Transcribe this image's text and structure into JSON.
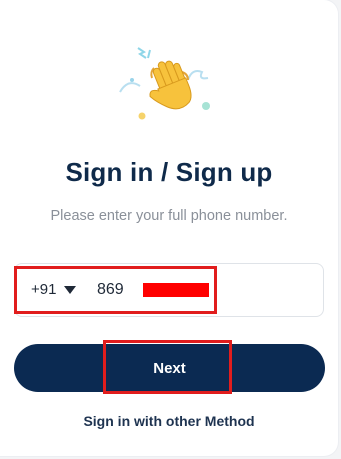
{
  "header": {
    "illustration_icon": "waving-hand-icon",
    "title": "Sign in / Sign up",
    "subtitle": "Please enter your full phone number."
  },
  "phone": {
    "country_code": "+91",
    "value": "869"
  },
  "actions": {
    "next_label": "Next",
    "other_method_label": "Sign in with other Method"
  },
  "colors": {
    "primary": "#0b2a52",
    "title": "#0f2a4a",
    "highlight": "#e11d1d",
    "redaction": "#ff0000"
  }
}
